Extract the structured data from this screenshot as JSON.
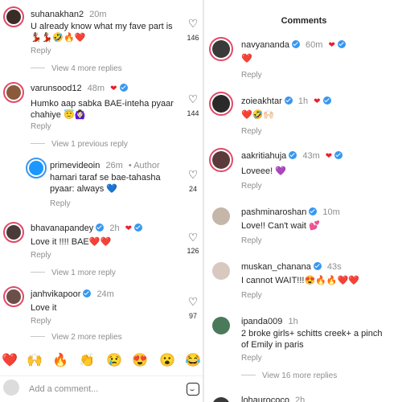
{
  "left": {
    "comments": [
      {
        "user": "suhanakhan2",
        "time": "20m",
        "text1": "U already know what my fave part is",
        "text2": "💃🏽💃🏽🤣🔥❤️",
        "reply": "Reply",
        "more": "View 4 more replies",
        "likes": "146",
        "verified": false,
        "ava": "#3a2d28"
      },
      {
        "user": "varunsood12",
        "time": "48m",
        "text1": "Humko aap sabka BAE-inteha pyaar",
        "text2": "chahiye 😇🙆🏻‍♀️",
        "reply": "Reply",
        "more": "View 1 previous reply",
        "likes": "144",
        "verified": false,
        "ava": "#8a5a3a"
      },
      {
        "user": "primevideoin",
        "time": "26m",
        "author": "• Author",
        "text1": "hamari taraf se bae-tahasha",
        "text2": "pyaar: always 💙",
        "reply": "Reply",
        "likes": "24",
        "verified": false,
        "ava": "#1a98ff"
      },
      {
        "user": "bhavanapandey",
        "time": "2h",
        "text1": "Love it !!!! BAE❤️❤️",
        "reply": "Reply",
        "more": "View 1 more reply",
        "likes": "126",
        "verified": true,
        "ava": "#4a3a38"
      },
      {
        "user": "janhvikapoor",
        "time": "24m",
        "text1": "Love it",
        "reply": "Reply",
        "more": "View 2 more replies",
        "likes": "97",
        "verified": true,
        "ava": "#6a5048"
      }
    ],
    "emojis": [
      "❤️",
      "🙌",
      "🔥",
      "👏",
      "😢",
      "😍",
      "😮",
      "😂"
    ],
    "add_placeholder": "Add a comment..."
  },
  "right": {
    "title": "Comments",
    "comments": [
      {
        "user": "navyananda",
        "time": "60m",
        "text": "❤️",
        "reply": "Reply",
        "ava": "#3a3a3a"
      },
      {
        "user": "zoieakhtar",
        "time": "1h",
        "text": "❤️🤣🙌🏻",
        "reply": "Reply",
        "ava": "#2a2a2a"
      },
      {
        "user": "aakritiahuja",
        "time": "43m",
        "text": "Loveee! 💜",
        "reply": "Reply",
        "ava": "#5a3a3a"
      },
      {
        "user": "pashminaroshan",
        "time": "10m",
        "text": "Love!! Can't wait 💕",
        "reply": "Reply",
        "ava": "#c4b6a8"
      },
      {
        "user": "muskan_chanana",
        "time": "43s",
        "text": "I cannot WAIT!!!😍🔥🔥❤️❤️",
        "reply": "Reply",
        "ava": "#d8c8c0"
      },
      {
        "user": "ipanda009",
        "time": "1h",
        "text1": "2 broke girls+ schitts creek+ a pinch",
        "text2": "of Emily in paris",
        "reply": "Reply",
        "more": "View 16 more replies",
        "ava": "#4a7a5a"
      },
      {
        "user": "lohaurococo",
        "time": "2h",
        "ava": "#3a3a3a"
      }
    ]
  },
  "colors": {
    "verified": "#3897f0",
    "heart": "#ed1c2c",
    "story_ring": "#e04a6a",
    "muted": "#8e8e8e"
  }
}
